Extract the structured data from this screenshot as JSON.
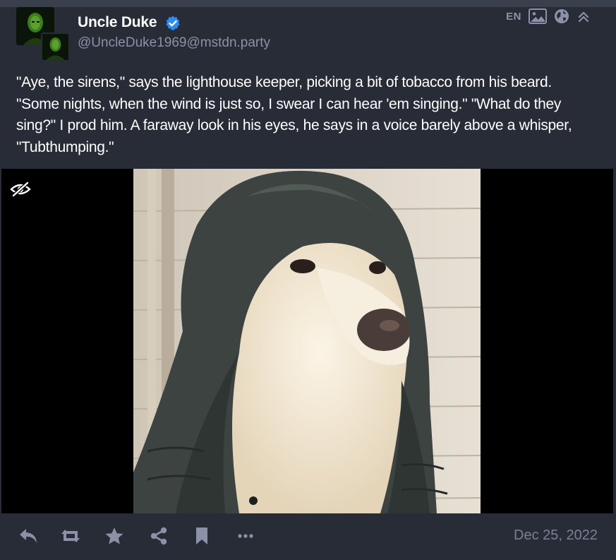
{
  "account": {
    "display_name": "Uncle Duke",
    "handle": "@UncleDuke1969@mstdn.party",
    "verified": true
  },
  "meta": {
    "language": "EN",
    "icons": [
      "image-icon",
      "globe-icon",
      "collapse-icon"
    ]
  },
  "post": {
    "text": "\"Aye, the sirens,\" says the lighthouse keeper, picking a bit of tobacco from his beard. \"Some nights, when the wind is just so, I swear I can hear 'em singing.\" \"What do they sing?\" I prod him. A faraway look in his eyes, he says in a voice barely above a whisper, \"Tubthumping.\""
  },
  "media": {
    "hide_icon": "eye-slash-icon"
  },
  "actions": {
    "icons": [
      "reply-icon",
      "boost-icon",
      "favourite-icon",
      "share-icon",
      "bookmark-icon",
      "more-icon"
    ],
    "timestamp": "Dec 25, 2022"
  },
  "colors": {
    "background": "#282c37",
    "muted_text": "#8b92a8",
    "verified_blue": "#2c8cf4",
    "media_background": "#000000"
  }
}
